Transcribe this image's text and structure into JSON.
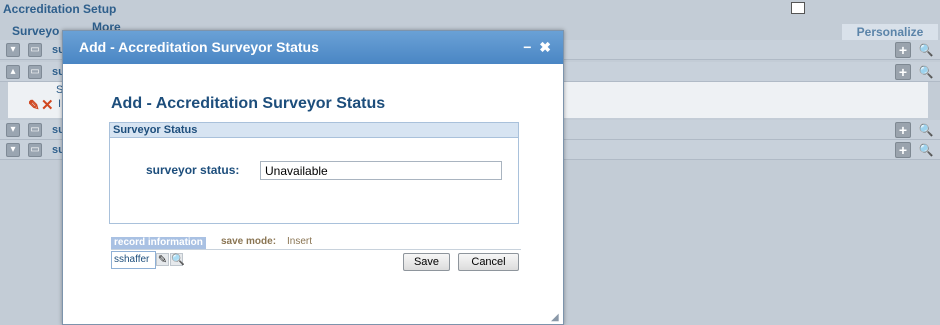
{
  "page": {
    "title": "Accreditation Setup",
    "personalize": "Personalize",
    "col_surveyor": "Surveyo",
    "col_more": "More"
  },
  "rows": [
    {
      "toggle": "▾",
      "text": "su"
    },
    {
      "toggle": "▴",
      "text": "su"
    },
    {
      "toggle": "▾",
      "text": "su"
    },
    {
      "toggle": "▾",
      "text": "su"
    }
  ],
  "expanded": {
    "snippet": "S",
    "snippet2": "I"
  },
  "modal": {
    "header_title": "Add - Accreditation Surveyor Status",
    "heading": "Add - Accreditation Surveyor Status",
    "section_title": "Surveyor Status",
    "field_label": "surveyor status:",
    "field_value": "Unavailable",
    "record_info_label": "record information",
    "save_mode_label": "save mode:",
    "save_mode_value": "Insert",
    "user": "sshaffer",
    "save_label": "Save",
    "cancel_label": "Cancel"
  },
  "icons": {
    "minimize": "minimize-icon",
    "close": "close-icon",
    "edit": "pencil-icon",
    "delete": "delete-x-icon",
    "search": "magnifier-icon",
    "add": "plus-icon"
  },
  "colors": {
    "header_blue": "#4a86c4",
    "heading_text": "#1d4e7c",
    "background": "#c3ccd6"
  }
}
